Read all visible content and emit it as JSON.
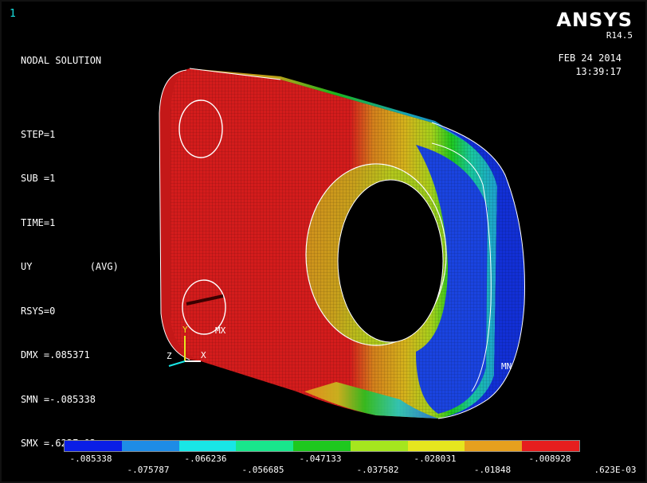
{
  "window_number": "1",
  "branding": {
    "logo": "ANSYS",
    "version": "R14.5"
  },
  "timestamp": {
    "date": "FEB 24 2014",
    "time": "13:39:17"
  },
  "info_lines": [
    "NODAL SOLUTION",
    "",
    "STEP=1",
    "SUB =1",
    "TIME=1",
    "UY          (AVG)",
    "RSYS=0",
    "DMX =.085371",
    "SMN =-.085338",
    "SMX =.623E-03"
  ],
  "markers": {
    "max": "MX",
    "min": "MN"
  },
  "triad": {
    "x": "X",
    "y": "Y",
    "z": "Z"
  },
  "legend": {
    "colors": [
      "#0a1ee6",
      "#1e8ce6",
      "#19e6e6",
      "#19e68c",
      "#1ec81e",
      "#a5e61e",
      "#e6e61e",
      "#e6a01e",
      "#e61e1e"
    ],
    "labels_top": [
      "-.085338",
      "-.066236",
      "-.047133",
      "-.028031",
      "-.008928"
    ],
    "labels_bottom": [
      "-.075787",
      "-.056685",
      "-.037582",
      "-.01848",
      ".623E-03"
    ]
  }
}
